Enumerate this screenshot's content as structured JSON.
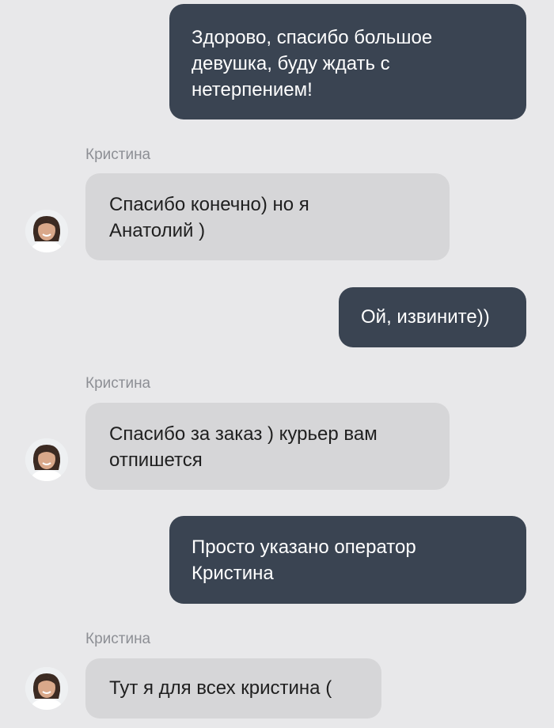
{
  "conversation": {
    "messages": [
      {
        "sender": "",
        "direction": "outgoing",
        "text": "Здорово, спасибо большое\nдевушка, буду ждать с\nнетерпением!"
      },
      {
        "sender": "Кристина",
        "direction": "incoming",
        "text": "Спасибо конечно) но я\nАнатолий )"
      },
      {
        "sender": "",
        "direction": "outgoing",
        "text": "Ой, извините))"
      },
      {
        "sender": "Кристина",
        "direction": "incoming",
        "text": "Спасибо за заказ ) курьер вам\nотпишется"
      },
      {
        "sender": "",
        "direction": "outgoing",
        "text": "Просто указано оператор\nКристина"
      },
      {
        "sender": "Кристина",
        "direction": "incoming",
        "text": "Тут я для всех кристина ("
      }
    ]
  },
  "colors": {
    "background": "#e8e8ea",
    "outgoing_bubble": "#3a4452",
    "incoming_bubble": "#d6d6d8",
    "sender_name": "#8d8f95"
  },
  "icons": {
    "avatar": "operator-avatar-photo"
  }
}
